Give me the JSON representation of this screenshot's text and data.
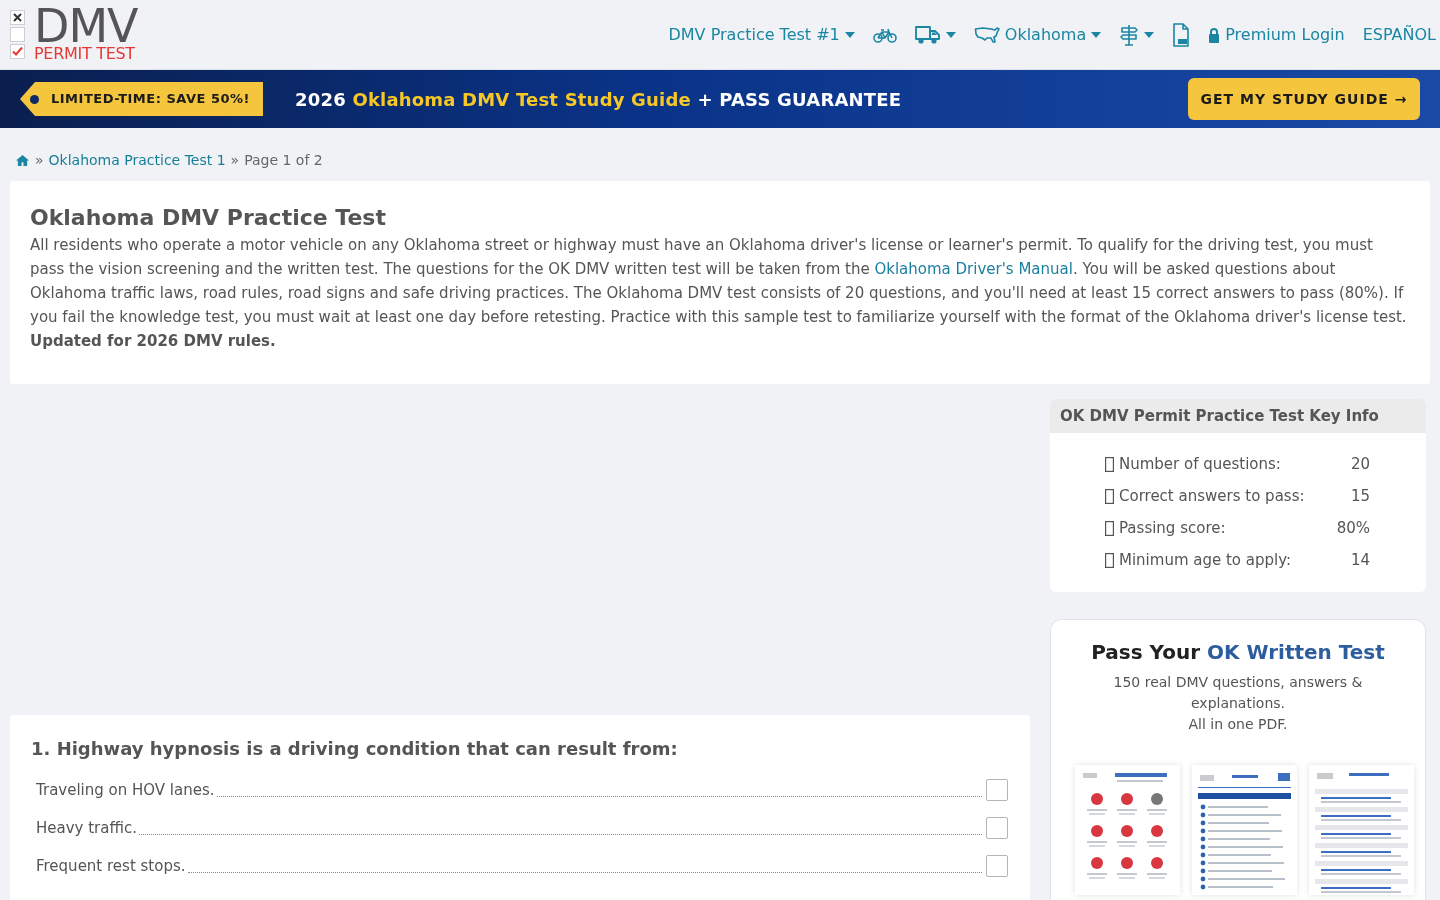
{
  "logo": {
    "title": "DMV",
    "subtitle": "PERMIT TEST"
  },
  "nav": [
    {
      "kind": "dropdown",
      "label": "DMV Practice Test #1"
    },
    {
      "kind": "link"
    },
    {
      "kind": "dropdown"
    },
    {
      "kind": "dropdown",
      "label": "Oklahoma"
    },
    {
      "kind": "dropdown"
    },
    {
      "kind": "link"
    },
    {
      "kind": "link",
      "label": "Premium Login"
    },
    {
      "kind": "link",
      "label": "ESPAÑOL"
    }
  ],
  "banner": {
    "tag": "LIMITED-TIME: SAVE 50%!",
    "headline": {
      "lead": "2026",
      "highlight": "Oklahoma DMV Test Study Guide",
      "tail": "+ PASS GUARANTEE"
    },
    "button": "GET MY STUDY GUIDE →"
  },
  "breadcrumb": [
    {
      "kind": "home"
    },
    {
      "kind": "separator",
      "text": "»"
    },
    {
      "kind": "link",
      "text": "Oklahoma Practice Test 1"
    },
    {
      "kind": "separator",
      "text": "»"
    },
    {
      "kind": "current",
      "text": "Page 1 of 2"
    }
  ],
  "intro": {
    "title": "Oklahoma DMV Practice Test",
    "text_before": "All residents who operate a motor vehicle on any Oklahoma street or highway must have an Oklahoma driver's license or learner's permit. To qualify for the driving test, you must pass the vision screening and the written test. The questions for the OK DMV written test will be taken from the",
    "link": "Oklahoma Driver's Manual",
    "text_after": ". You will be asked questions about Oklahoma traffic laws, road rules, road signs and safe driving practices. The Oklahoma DMV test consists of 20 questions, and you'll need at least 15 correct answers to pass (80%). If you fail the knowledge test, you must wait at least one day before retesting. Practice with this sample test to familiarize yourself with the format of the Oklahoma driver's license test.",
    "note": "Updated for 2026 DMV rules."
  },
  "question": {
    "title": "1. Highway hypnosis is a driving condition that can result from:",
    "answers": [
      {
        "text": "Traveling on HOV lanes.",
        "checked": false
      },
      {
        "text": "Heavy traffic.",
        "checked": false
      },
      {
        "text": "Frequent rest stops.",
        "checked": false
      }
    ]
  },
  "key_info": {
    "title": "OK DMV Permit Practice Test Key Info",
    "rows": [
      {
        "label": "Number of questions:",
        "value": "20"
      },
      {
        "label": "Correct answers to pass:",
        "value": "15"
      },
      {
        "label": "Passing score:",
        "value": "80%"
      },
      {
        "label": "Minimum age to apply:",
        "value": "14"
      }
    ]
  },
  "promo": {
    "title": {
      "lead": "Pass Your",
      "highlight": "OK Written Test"
    },
    "lines": [
      "150 real DMV questions, answers & explanations.",
      "All in one PDF."
    ]
  }
}
